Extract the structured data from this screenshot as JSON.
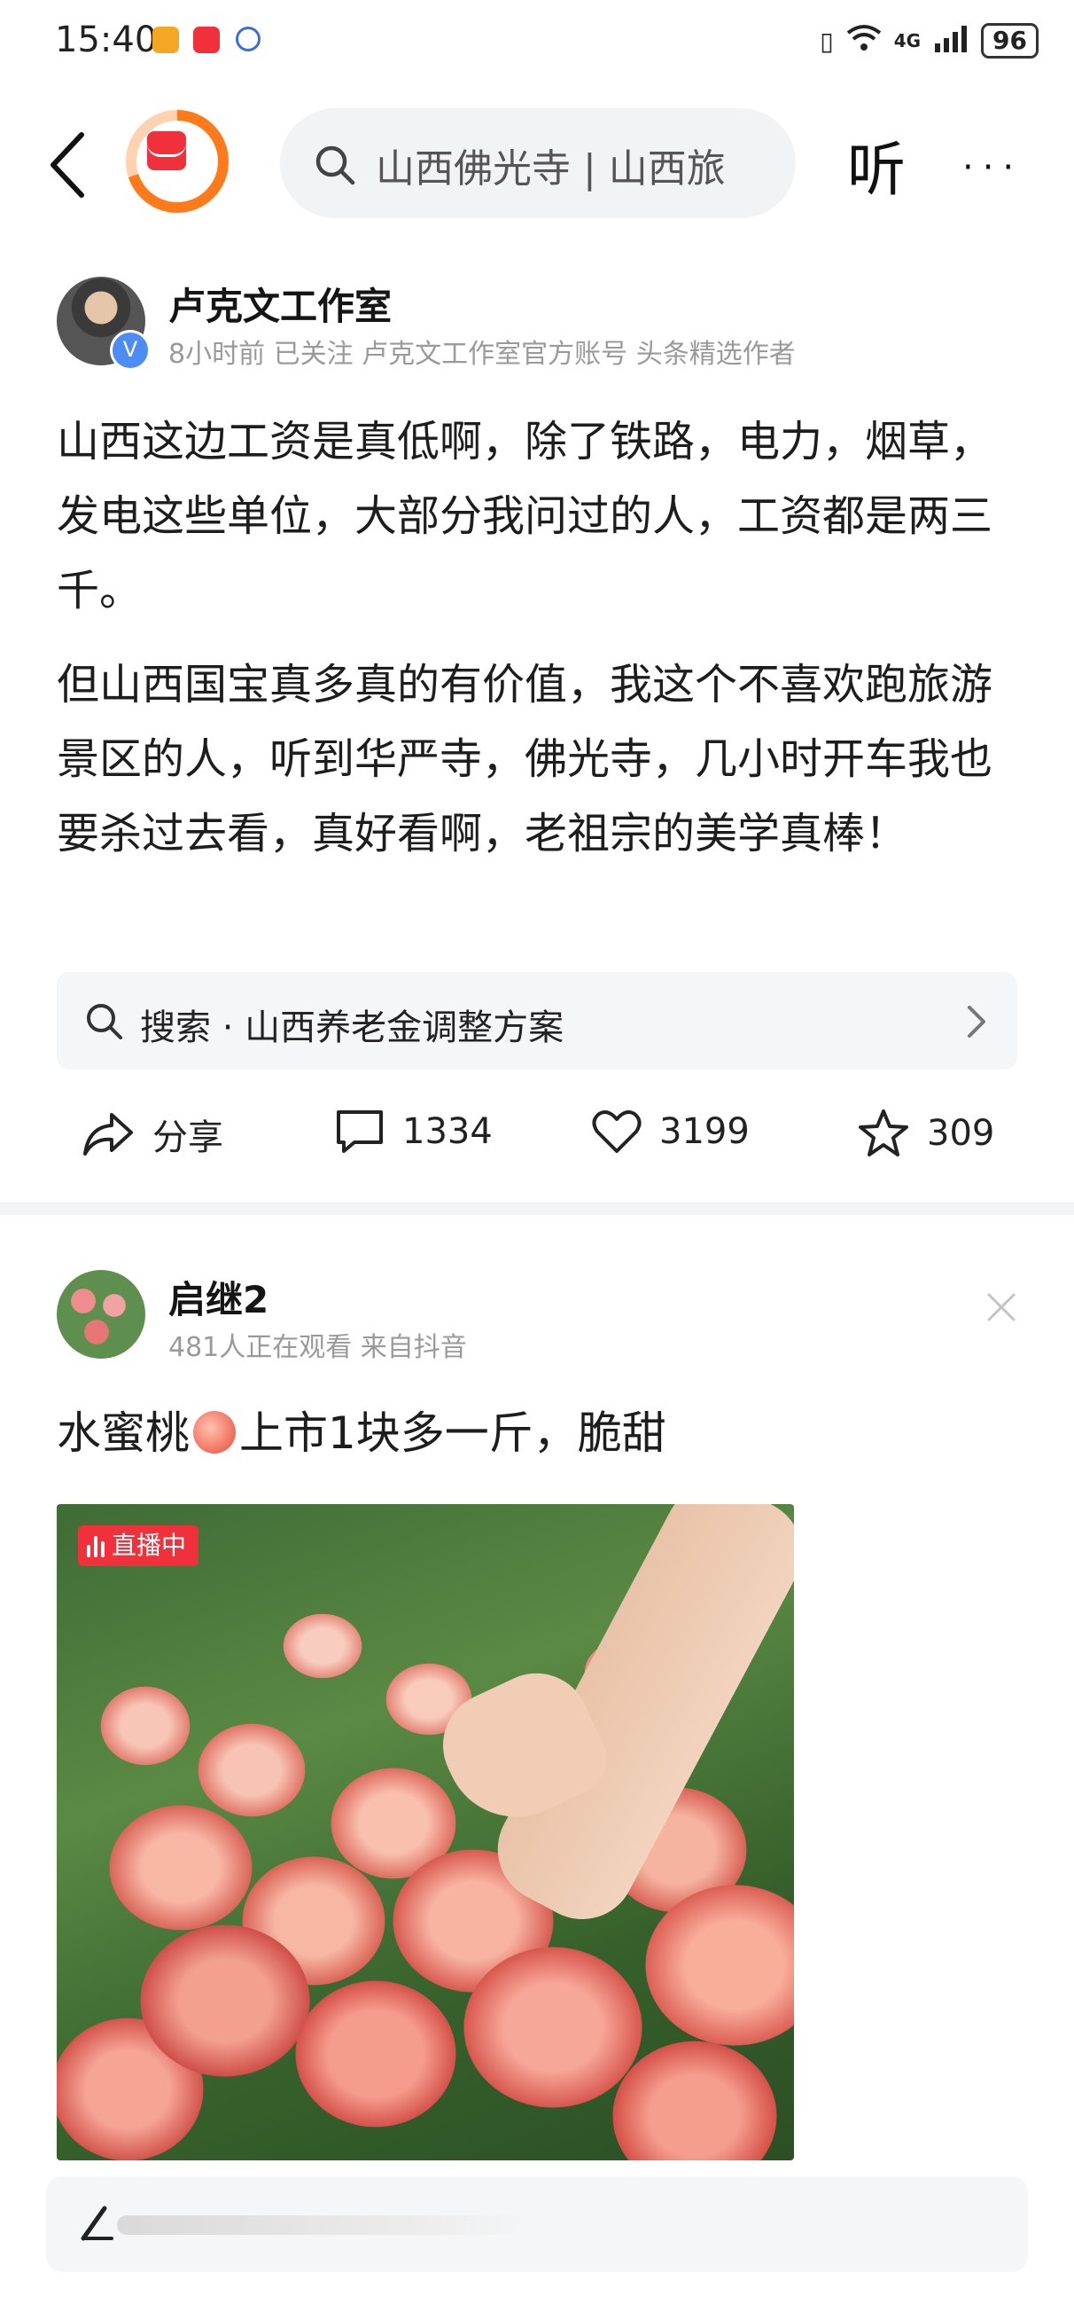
{
  "status_bar": {
    "time": "15:40",
    "network": "4G",
    "battery": "96",
    "icons": [
      "app-orange-icon",
      "app-red-icon",
      "baidu-icon",
      "vibrate-icon",
      "wifi-icon",
      "signal-icon",
      "battery-icon"
    ],
    "colors": {
      "orange_icon": "#f5a623",
      "red_icon": "#f0313c",
      "baidu_icon": "#3a6fd9"
    }
  },
  "nav": {
    "search_text": "山西佛光寺 | 山西旅",
    "listen_label": "听",
    "more_label": "···"
  },
  "post1": {
    "author": "卢克文工作室",
    "meta": "8小时前   已关注   卢克文工作室官方账号 头条精选作者",
    "verified_badge": "V",
    "paragraph1": "山西这边工资是真低啊，除了铁路，电力，烟草，发电这些单位，大部分我问过的人，工资都是两三千。",
    "paragraph2": "但山西国宝真多真的有价值，我这个不喜欢跑旅游景区的人，听到华严寺，佛光寺，几小时开车我也要杀过去看，真好看啊，老祖宗的美学真棒！",
    "search_suggestion": "搜索 · 山西养老金调整方案",
    "actions": {
      "share": "分享",
      "comments": "1334",
      "likes": "3199",
      "favorites": "309"
    }
  },
  "post2": {
    "author": "启继2",
    "meta": "481人正在观看   来自抖音",
    "title_before": "水蜜桃",
    "title_after": "上市1块多一斤，脆甜",
    "live_badge": "直播中",
    "colors": {
      "live_red": "#f0313c"
    }
  },
  "colors": {
    "accent_blue": "#4d8bf5",
    "logo_orange": "#ff7a1a",
    "divider": "#f3f4f6"
  }
}
